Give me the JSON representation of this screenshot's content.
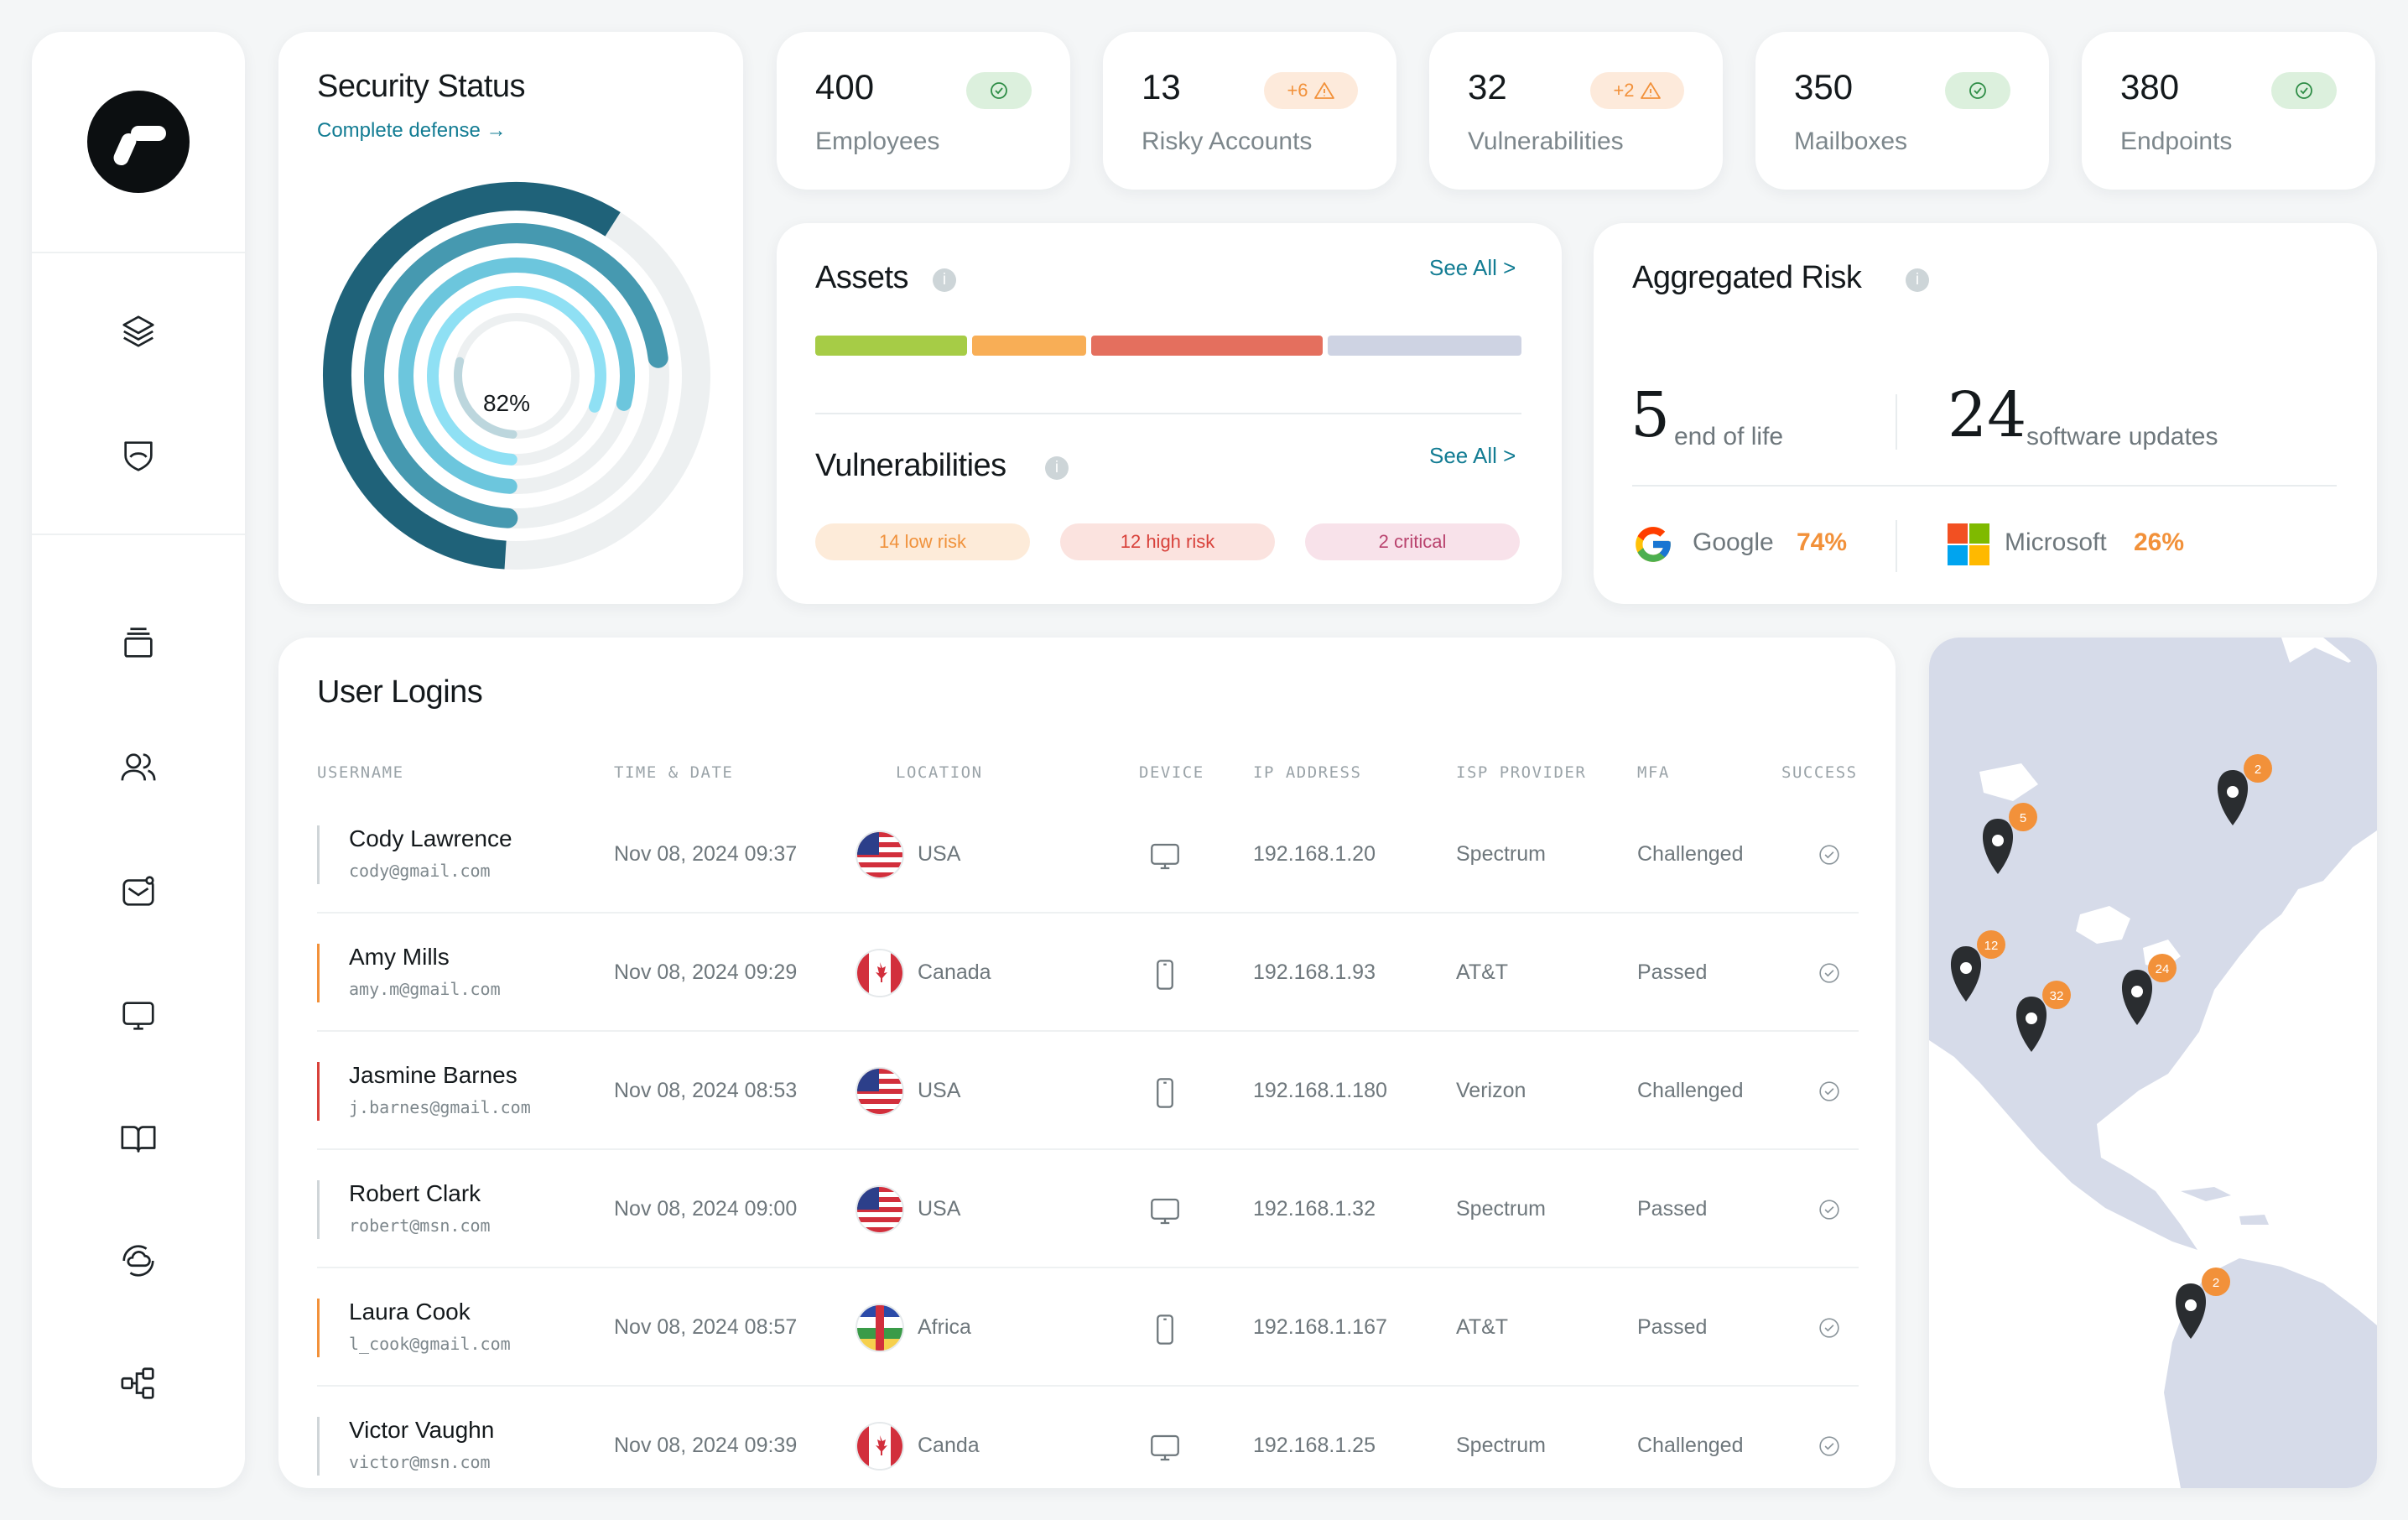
{
  "colors": {
    "accent": "#127c93",
    "orange": "#f2913a",
    "success_bg": "#dcf0dd",
    "warning_bg": "#fdeadb"
  },
  "sidebar": {
    "items": [
      {
        "name": "layers-icon"
      },
      {
        "name": "shield-icon"
      },
      {
        "name": "stack-icon"
      },
      {
        "name": "users-icon"
      },
      {
        "name": "mail-notification-icon"
      },
      {
        "name": "monitor-icon"
      },
      {
        "name": "book-icon"
      },
      {
        "name": "sync-cloud-icon"
      },
      {
        "name": "network-icon"
      }
    ]
  },
  "security": {
    "title": "Security Status",
    "link": "Complete defense →",
    "percent_label": "82%",
    "percent": 82
  },
  "stats": [
    {
      "value": "400",
      "label": "Employees",
      "badge": "ok"
    },
    {
      "value": "13",
      "label": "Risky Accounts",
      "badge": "warn",
      "delta": "+6"
    },
    {
      "value": "32",
      "label": "Vulnerabilities",
      "badge": "warn",
      "delta": "+2"
    },
    {
      "value": "350",
      "label": "Mailboxes",
      "badge": "ok"
    },
    {
      "value": "380",
      "label": "Endpoints",
      "badge": "ok"
    }
  ],
  "assets": {
    "title": "Assets",
    "see_all": "See All >",
    "segments": [
      {
        "color": "#a6cc46",
        "share": 0.22
      },
      {
        "color": "#f8ae56",
        "share": 0.165
      },
      {
        "color": "#e46f5e",
        "share": 0.335
      },
      {
        "color": "#ced3e3",
        "share": 0.28
      }
    ]
  },
  "vulnerabilities": {
    "title": "Vulnerabilities",
    "see_all": "See All >",
    "pills": [
      {
        "label": "14 low risk",
        "bg": "#fdebd9",
        "fg": "#f0923c"
      },
      {
        "label": "12 high risk",
        "bg": "#fbe3df",
        "fg": "#d8413a"
      },
      {
        "label": "2 critical",
        "bg": "#f8e2ea",
        "fg": "#b9436e"
      }
    ]
  },
  "risk": {
    "title": "Aggregated Risk",
    "eol_num": "5",
    "eol_text": "end of life",
    "upd_num": "24",
    "upd_text": "software updates",
    "vendors": [
      {
        "name": "Google",
        "pct": "74%"
      },
      {
        "name": "Microsoft",
        "pct": "26%"
      }
    ]
  },
  "logins": {
    "title": "User Logins",
    "headers": [
      "USERNAME",
      "TIME & DATE",
      "LOCATION",
      "DEVICE",
      "IP ADDRESS",
      "ISP PROVIDER",
      "MFA",
      "SUCCESS"
    ],
    "rows": [
      {
        "name": "Cody Lawrence",
        "email": "cody@gmail.com",
        "time": "Nov 08, 2024  09:37",
        "location": "USA",
        "flag": "us",
        "device": "desktop",
        "ip": "192.168.1.20",
        "isp": "Spectrum",
        "mfa": "Challenged",
        "marker": "#cfd5d8"
      },
      {
        "name": "Amy Mills",
        "email": "amy.m@gmail.com",
        "time": "Nov 08, 2024  09:29",
        "location": "Canada",
        "flag": "ca",
        "device": "mobile",
        "ip": "192.168.1.93",
        "isp": "AT&T",
        "mfa": "Passed",
        "marker": "#f2913a"
      },
      {
        "name": "Jasmine Barnes",
        "email": "j.barnes@gmail.com",
        "time": "Nov 08, 2024  08:53",
        "location": "USA",
        "flag": "us",
        "device": "mobile",
        "ip": "192.168.1.180",
        "isp": "Verizon",
        "mfa": "Challenged",
        "marker": "#d8413a"
      },
      {
        "name": "Robert Clark",
        "email": "robert@msn.com",
        "time": "Nov 08, 2024  09:00",
        "location": "USA",
        "flag": "us",
        "device": "desktop",
        "ip": "192.168.1.32",
        "isp": "Spectrum",
        "mfa": "Passed",
        "marker": "#cfd5d8"
      },
      {
        "name": "Laura Cook",
        "email": "l_cook@gmail.com",
        "time": "Nov 08, 2024  08:57",
        "location": "Africa",
        "flag": "cf",
        "device": "mobile",
        "ip": "192.168.1.167",
        "isp": "AT&T",
        "mfa": "Passed",
        "marker": "#f2913a"
      },
      {
        "name": "Victor Vaughn",
        "email": "victor@msn.com",
        "time": "Nov 08, 2024  09:39",
        "location": "Canda",
        "flag": "ca",
        "device": "desktop",
        "ip": "192.168.1.25",
        "isp": "Spectrum",
        "mfa": "Challenged",
        "marker": "#cfd5d8"
      }
    ]
  },
  "map": {
    "pins": [
      {
        "count": "5"
      },
      {
        "count": "2"
      },
      {
        "count": "12"
      },
      {
        "count": "24"
      },
      {
        "count": "32"
      },
      {
        "count": "2"
      }
    ]
  }
}
